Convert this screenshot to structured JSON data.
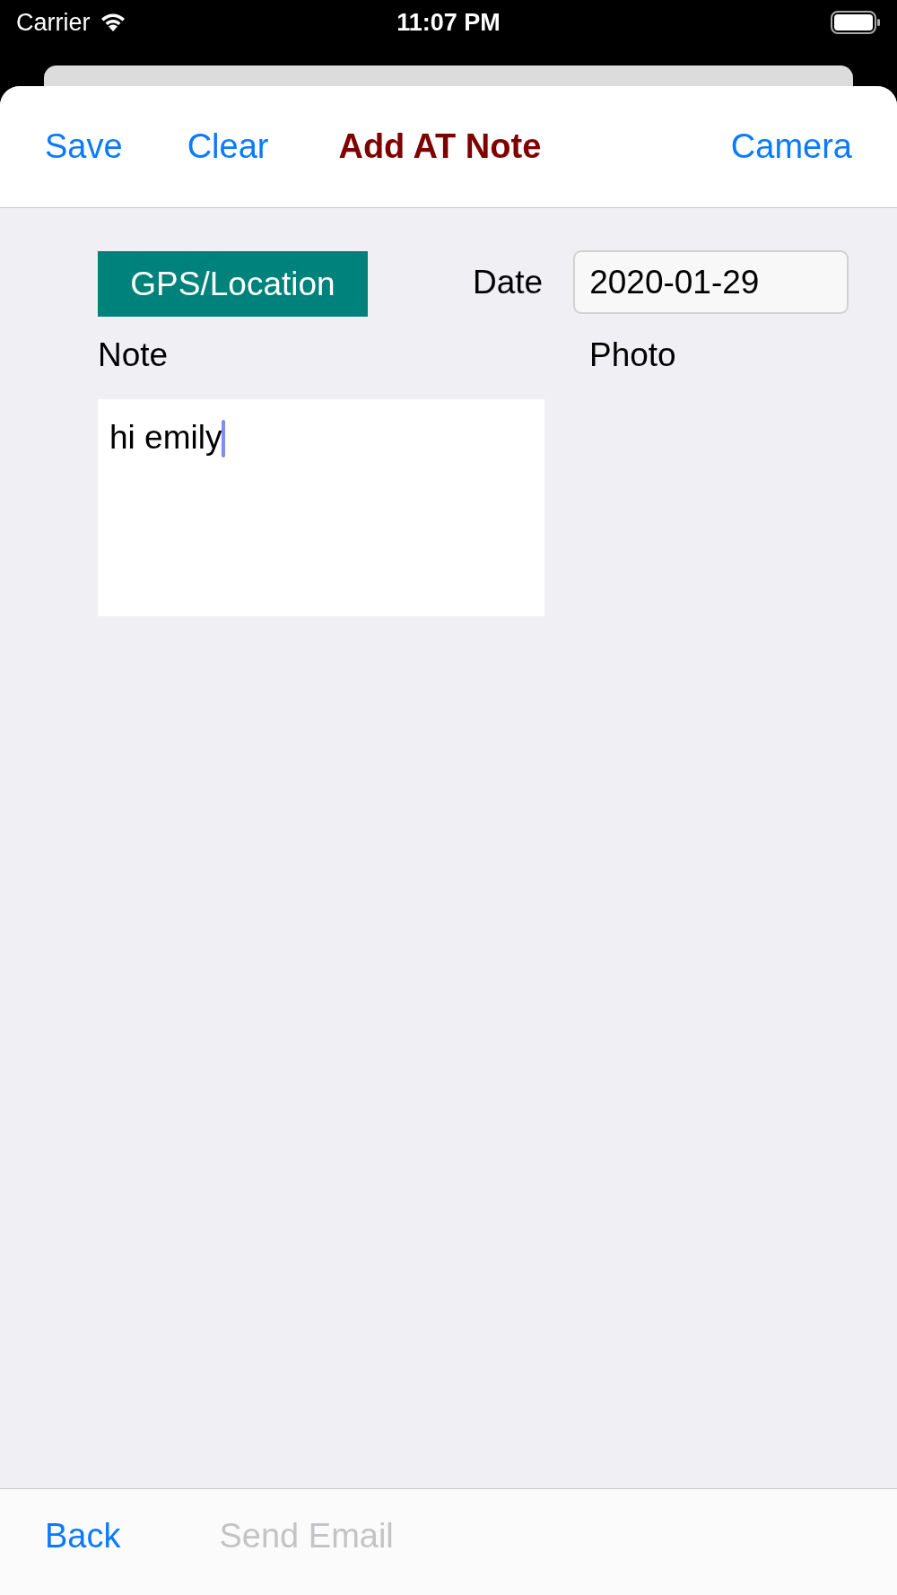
{
  "status_bar": {
    "carrier": "Carrier",
    "time": "11:07 PM"
  },
  "nav_bar": {
    "items": [
      {
        "kind": "button",
        "label": "Save"
      },
      {
        "kind": "button",
        "label": "Clear"
      },
      {
        "kind": "title",
        "label": "Add AT Note"
      },
      {
        "kind": "trailing",
        "label": "Camera"
      }
    ]
  },
  "form": {
    "gps_button": "GPS/Location",
    "date_label": "Date",
    "date_value": "2020-01-29",
    "note_label": "Note",
    "note_value": "hi emily",
    "photo_label": "Photo"
  },
  "toolbar": {
    "buttons": [
      {
        "label": "Back",
        "disabled": false
      },
      {
        "label": "Send Email",
        "disabled": true
      }
    ]
  }
}
